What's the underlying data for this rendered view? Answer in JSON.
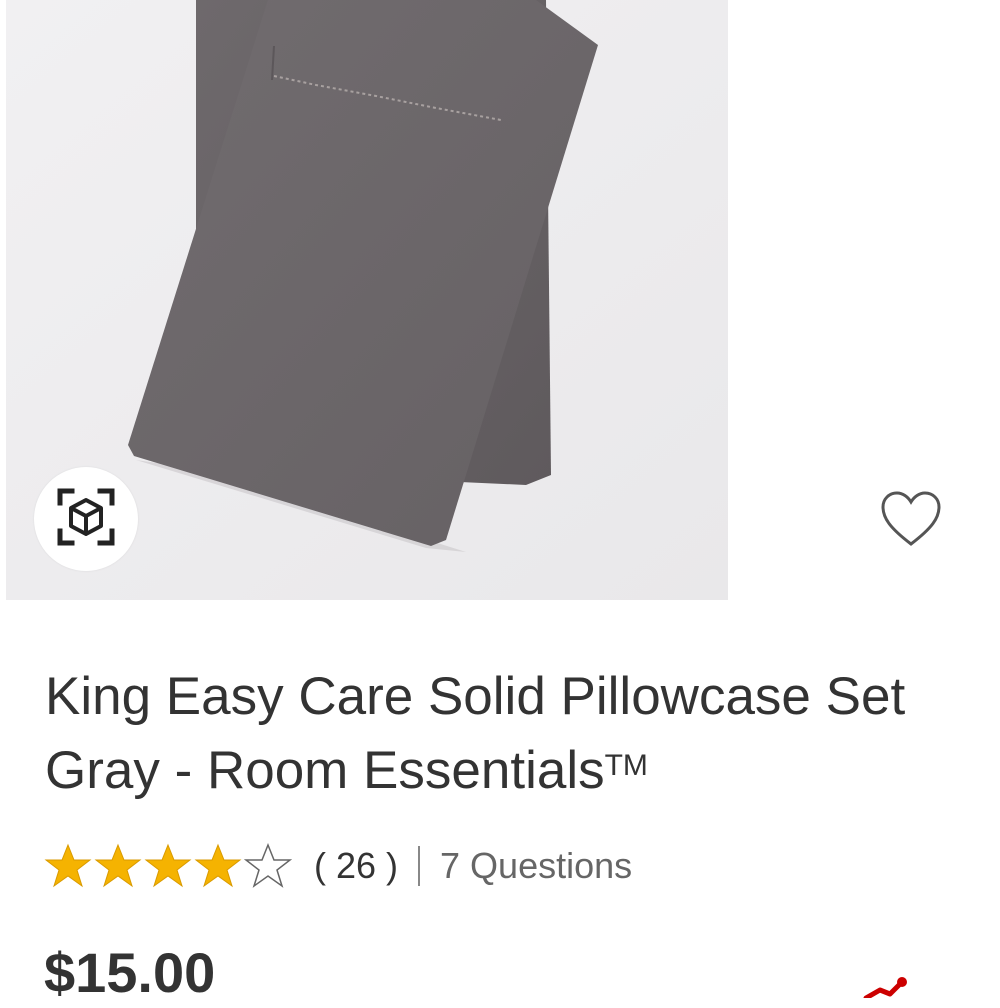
{
  "product": {
    "title": "King Easy Care Solid Pillowcase Set Gray - Room Essentials",
    "trademark": "TM",
    "rating": {
      "value": 4,
      "max": 5
    },
    "review_count": "( 26 )",
    "questions_link": "7 Questions",
    "price": "$15.00"
  },
  "icons": {
    "ar_view": "ar-cube-icon",
    "favorite": "heart-outline-icon",
    "star_filled": "star-filled-icon",
    "star_empty": "star-empty-icon",
    "partial": "red-graphic-icon"
  },
  "colors": {
    "star": "#f5b301",
    "text": "#333333",
    "muted": "#666666",
    "image_bg": "#eeedef",
    "fabric": "#6b6669",
    "accent": "#cc0000"
  }
}
